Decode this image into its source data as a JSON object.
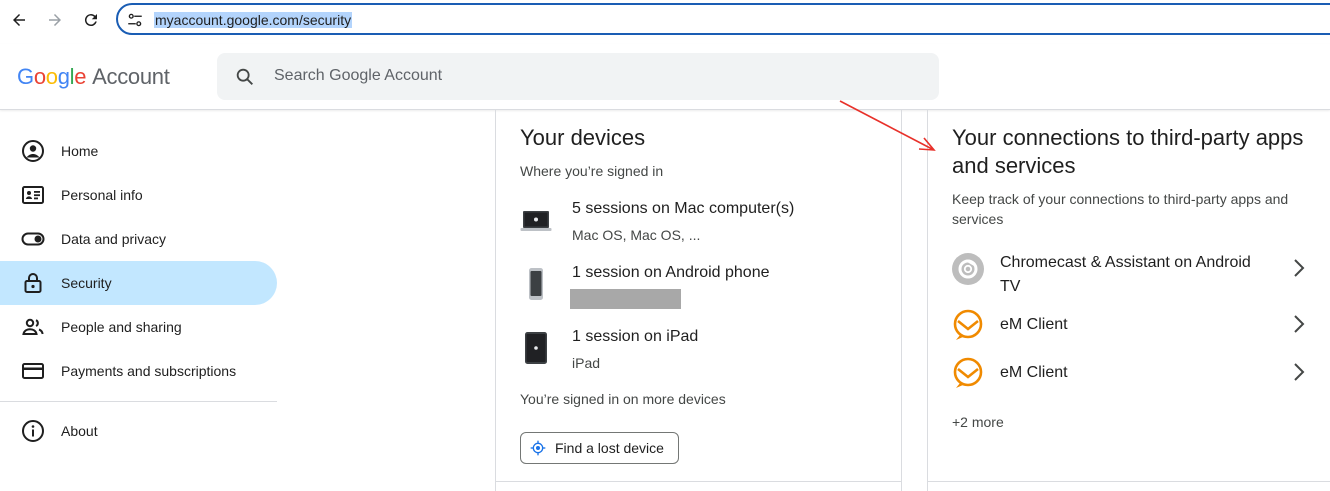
{
  "browser": {
    "url": "myaccount.google.com/security"
  },
  "header": {
    "logo_letters": [
      "G",
      "o",
      "o",
      "g",
      "l",
      "e"
    ],
    "logo_product": "Account",
    "search_placeholder": "Search Google Account"
  },
  "sidebar": {
    "items": [
      {
        "label": "Home",
        "icon": "account-circle-icon"
      },
      {
        "label": "Personal info",
        "icon": "id-card-icon"
      },
      {
        "label": "Data and privacy",
        "icon": "toggle-icon"
      },
      {
        "label": "Security",
        "icon": "lock-icon",
        "active": true
      },
      {
        "label": "People and sharing",
        "icon": "people-icon"
      },
      {
        "label": "Payments and subscriptions",
        "icon": "credit-card-icon"
      },
      {
        "label": "About",
        "icon": "info-icon"
      }
    ]
  },
  "devices": {
    "title": "Your devices",
    "subtitle": "Where you’re signed in",
    "rows": [
      {
        "title": "5 sessions on Mac computer(s)",
        "detail": "Mac OS, Mac OS, ...",
        "icon": "laptop-icon"
      },
      {
        "title": "1 session on Android phone",
        "detail": "",
        "icon": "android-phone-icon"
      },
      {
        "title": "1 session on iPad",
        "detail": "iPad",
        "icon": "ipad-icon"
      }
    ],
    "more_text": "You’re signed in on more devices",
    "find_button": "Find a lost device"
  },
  "connections": {
    "title": "Your connections to third-party apps and services",
    "subtitle": "Keep track of your connections to third-party apps and services",
    "rows": [
      {
        "label": "Chromecast & Assistant on Android TV",
        "icon": "chromecast-icon"
      },
      {
        "label": "eM Client",
        "icon": "em-client-icon"
      },
      {
        "label": "eM Client",
        "icon": "em-client-icon"
      }
    ],
    "more": "+2 more"
  },
  "colors": {
    "accent": "#1a5db4",
    "active_nav": "#c2e7ff",
    "em_client": "#f08a00",
    "annotation_arrow": "#e8312a"
  }
}
